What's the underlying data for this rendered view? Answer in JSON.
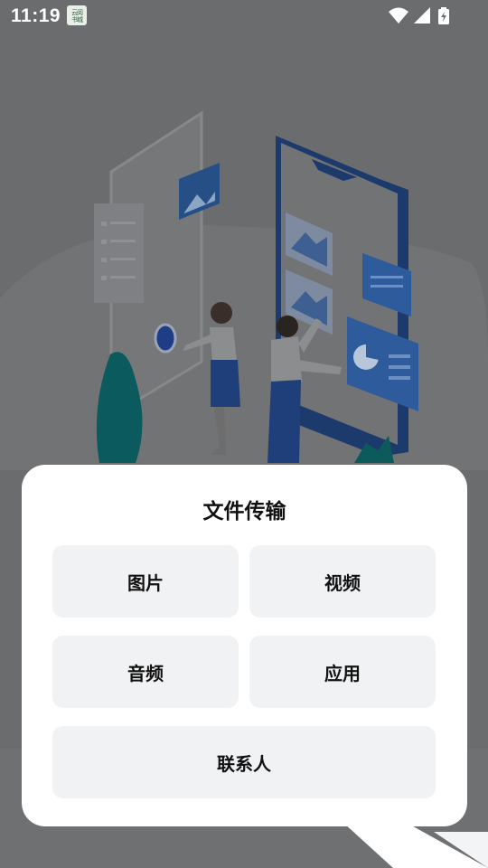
{
  "status_bar": {
    "time": "11:19",
    "icons": [
      "notification-app-icon",
      "wifi-icon",
      "signal-icon",
      "battery-charging-icon"
    ]
  },
  "dialog": {
    "title": "文件传输",
    "options": [
      {
        "label": "图片"
      },
      {
        "label": "视频"
      },
      {
        "label": "音频"
      },
      {
        "label": "应用"
      },
      {
        "label": "联系人"
      }
    ]
  },
  "colors": {
    "overlay": "#6b6c6d",
    "dialog_bg": "#ffffff",
    "option_bg": "#f1f2f4",
    "text": "#111111",
    "illustration_blue": "#1e5aa8",
    "illustration_teal": "#0b6a6a"
  }
}
